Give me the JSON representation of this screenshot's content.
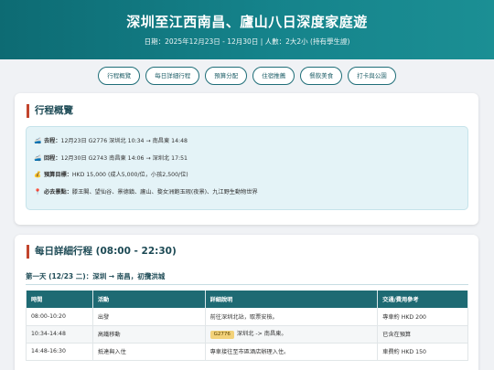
{
  "header": {
    "title": "深圳至江西南昌、廬山八日深度家庭遊",
    "subtitle": "日期：2025年12月23日 - 12月30日 | 人數：2大2小 (持有學生證)"
  },
  "nav": [
    {
      "label": "行程概覽"
    },
    {
      "label": "每日詳細行程"
    },
    {
      "label": "預算分配"
    },
    {
      "label": "住宿推薦"
    },
    {
      "label": "餐飲美食"
    },
    {
      "label": "打卡與公園"
    }
  ],
  "overview": {
    "title": "行程概覽",
    "rows": [
      {
        "icon": "🚄",
        "icon_name": "train-icon",
        "label": "去程：",
        "text": "12月23日 G2776 深圳北 10:34 → 南昌東 14:48"
      },
      {
        "icon": "🚄",
        "icon_name": "train-icon",
        "label": "回程：",
        "text": "12月30日 G2743 南昌東 14:06 → 深圳北 17:51"
      },
      {
        "icon": "💰",
        "icon_name": "money-bag-icon",
        "label": "預算目標：",
        "text": "HKD 15,000 (成人5,000/位，小孩2,500/位)"
      },
      {
        "icon": "📍",
        "icon_name": "pin-icon",
        "label": "必去景點：",
        "text": "滕王閣、望仙谷、景德鎮、廬山、婺女洲飽玉瑕(夜景)、九江野生動物世界"
      }
    ]
  },
  "itinerary": {
    "title": "每日詳細行程 (08:00 - 22:30)",
    "day1_title": "第一天 (12/23 二)：深圳 → 南昌，初攬洪城",
    "columns": [
      "時間",
      "活動",
      "詳細說明",
      "交通/費用參考"
    ],
    "rows": [
      {
        "time": "08:00-10:20",
        "activity": "出發",
        "badge": "",
        "detail": "前往深圳北站，取票安檢。",
        "cost": "專車約 HKD 200"
      },
      {
        "time": "10:34-14:48",
        "activity": "高鐵移動",
        "badge": "G2776",
        "detail": "深圳北 -> 南昌東。",
        "cost": "已含在預算"
      },
      {
        "time": "14:48-16:30",
        "activity": "抵達與入住",
        "badge": "",
        "detail": "專車接往至市區酒店辦理入住。",
        "cost": "車費約 HKD 150"
      }
    ]
  },
  "colors": {
    "header_bg": "#15838b",
    "accent_red": "#c2452d",
    "table_header": "#1e6a73",
    "overview_bg": "#e4f3f7",
    "badge_bg": "#f3d27a"
  }
}
